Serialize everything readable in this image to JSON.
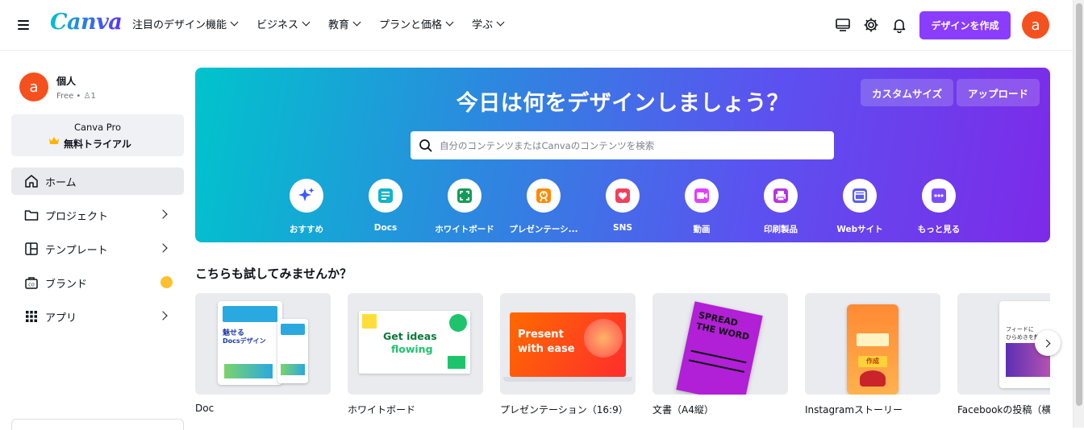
{
  "header": {
    "logo": "Canva",
    "nav": [
      {
        "label": "注目のデザイン機能"
      },
      {
        "label": "ビジネス"
      },
      {
        "label": "教育"
      },
      {
        "label": "プランと価格"
      },
      {
        "label": "学ぶ"
      }
    ],
    "create_button": "デザインを作成",
    "avatar_initial": "a",
    "icons": [
      "desktop-app-icon",
      "gear-icon",
      "bell-icon"
    ]
  },
  "sidebar": {
    "account": {
      "initial": "a",
      "name": "個人",
      "plan": "Free • ",
      "members": "1"
    },
    "pro_trial": {
      "line1": "Canva Pro",
      "line2": "無料トライアル"
    },
    "items": [
      {
        "label": "ホーム",
        "icon": "home-icon"
      },
      {
        "label": "プロジェクト",
        "icon": "folder-icon"
      },
      {
        "label": "テンプレート",
        "icon": "template-icon"
      },
      {
        "label": "ブランド",
        "icon": "brand-icon"
      },
      {
        "label": "アプリ",
        "icon": "apps-grid-icon"
      }
    ]
  },
  "hero": {
    "title": "今日は何をデザインしましょう？",
    "custom_size": "カスタムサイズ",
    "upload": "アップロード",
    "search_placeholder": "自分のコンテンツまたはCanvaのコンテンツを検索",
    "categories": [
      {
        "label": "おすすめ",
        "icon": "sparkle-icon",
        "color": "#3d5afe"
      },
      {
        "label": "Docs",
        "icon": "docs-icon",
        "color": "#12b5cb"
      },
      {
        "label": "ホワイトボード",
        "icon": "whiteboard-icon",
        "color": "#0f9d58"
      },
      {
        "label": "プレゼンテーシ...",
        "icon": "presentation-icon",
        "color": "#ff8a00"
      },
      {
        "label": "SNS",
        "icon": "heart-icon",
        "color": "#f43f5e"
      },
      {
        "label": "動画",
        "icon": "video-icon",
        "color": "#e040fb"
      },
      {
        "label": "印刷製品",
        "icon": "print-icon",
        "color": "#b832e5"
      },
      {
        "label": "Webサイト",
        "icon": "website-icon",
        "color": "#5b5fef"
      },
      {
        "label": "もっと見る",
        "icon": "more-dots-icon",
        "color": "#7c4dff"
      }
    ]
  },
  "section": {
    "title": "こちらも試してみませんか？",
    "cards": [
      {
        "caption": "Doc",
        "thumb_text_1": "魅せる",
        "thumb_text_2": "Docsデザイン"
      },
      {
        "caption": "ホワイトボード",
        "thumb_text_1": "Get ideas",
        "thumb_text_2": "flowing"
      },
      {
        "caption": "プレゼンテーション（16:9）",
        "thumb_text_1": "Present",
        "thumb_text_2": "with ease"
      },
      {
        "caption": "文書（A4縦）",
        "thumb_text_1": "SPREAD",
        "thumb_text_2": "THE WORD"
      },
      {
        "caption": "Instagramストーリー",
        "thumb_text_1": "作成",
        "thumb_text_2": ""
      },
      {
        "caption": "Facebookの投稿（横",
        "thumb_text_1": "フィードに",
        "thumb_text_2": "ひらめきを散らして"
      }
    ]
  }
}
